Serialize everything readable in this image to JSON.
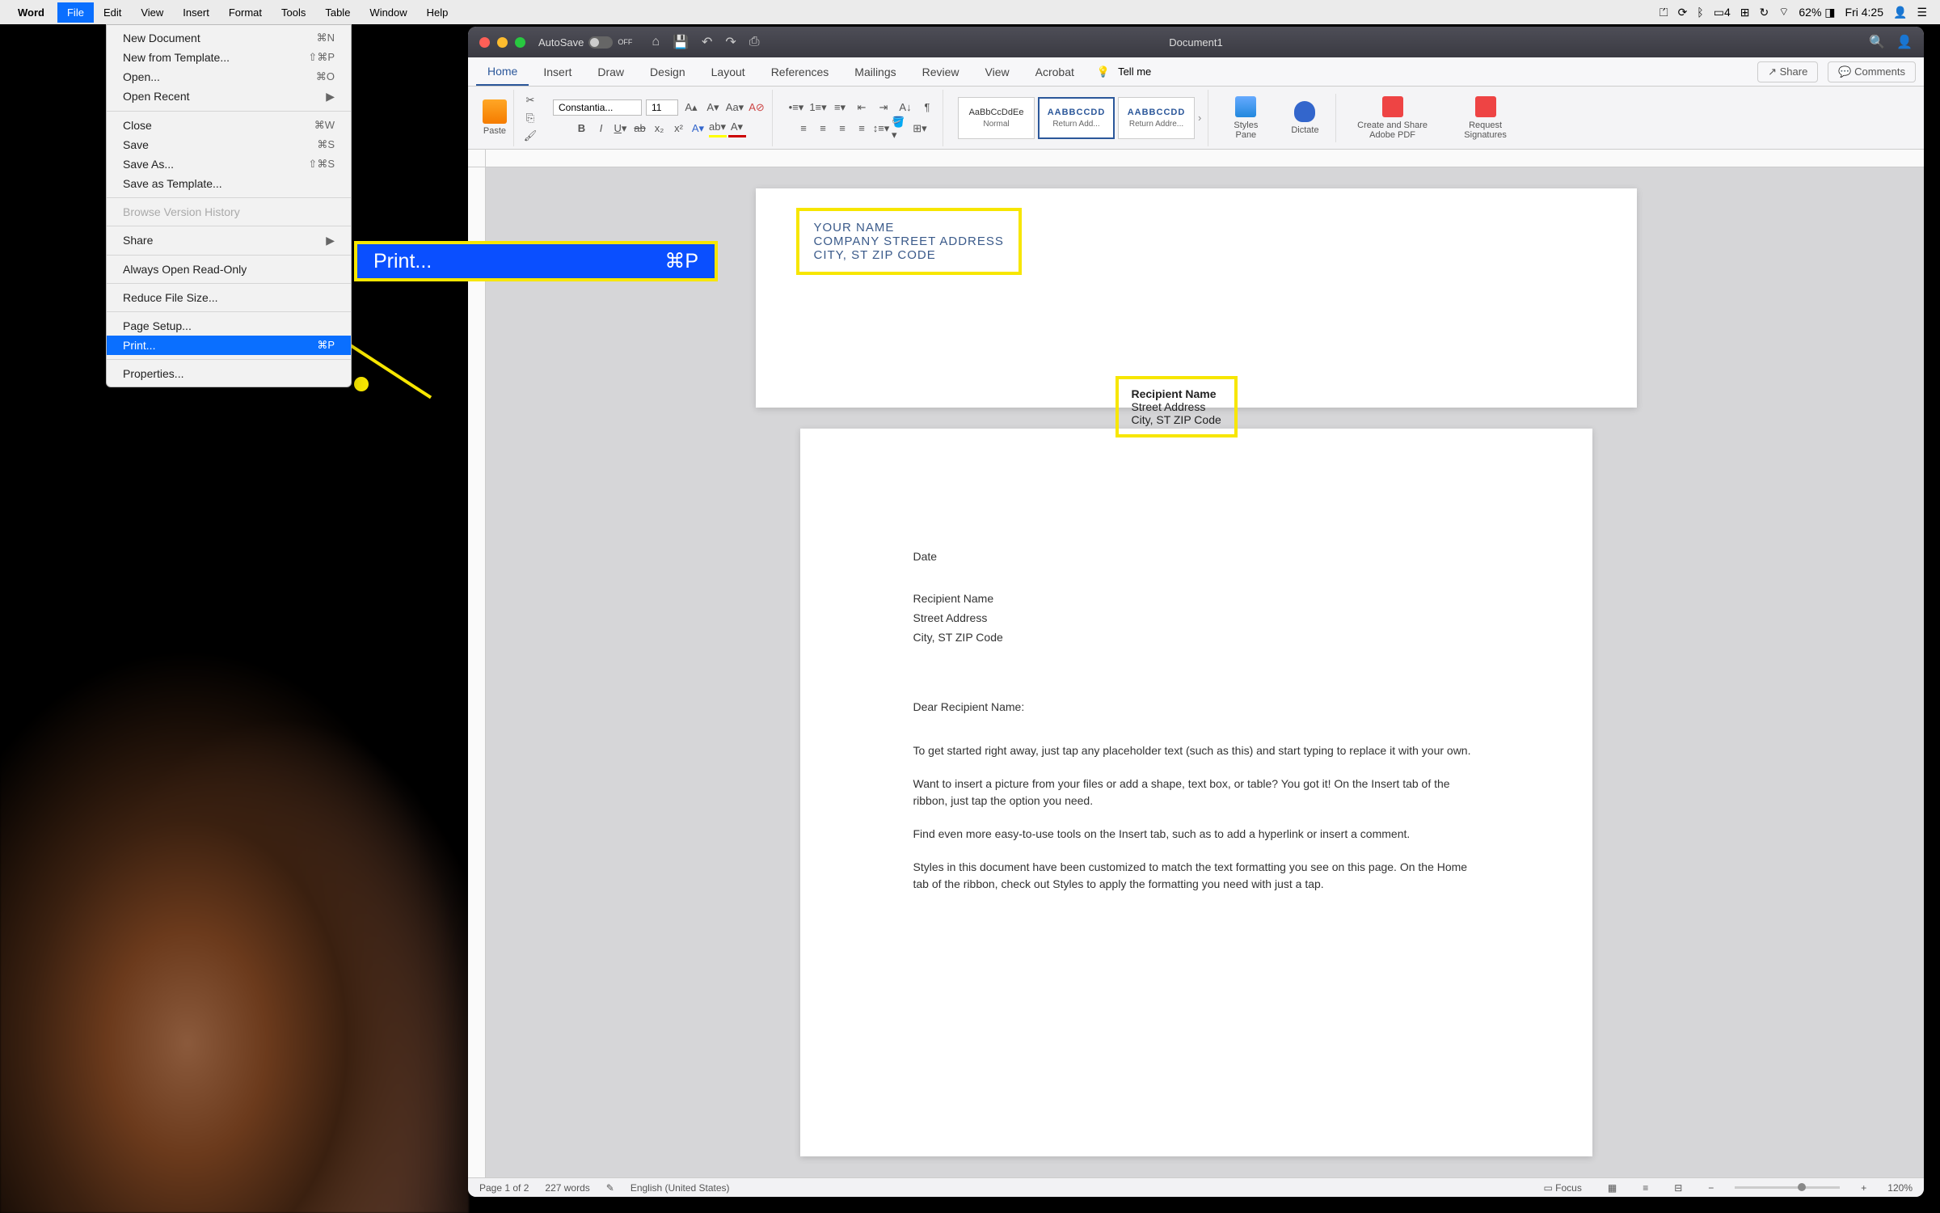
{
  "menubar": {
    "app_name": "Word",
    "items": [
      "File",
      "Edit",
      "View",
      "Insert",
      "Format",
      "Tools",
      "Table",
      "Window",
      "Help"
    ],
    "active_index": 0,
    "right": {
      "battery": "62%",
      "time": "Fri 4:25",
      "calendar_num": "4"
    }
  },
  "file_menu": {
    "items": [
      {
        "label": "New Document",
        "shortcut": "⌘N"
      },
      {
        "label": "New from Template...",
        "shortcut": "⇧⌘P"
      },
      {
        "label": "Open...",
        "shortcut": "⌘O"
      },
      {
        "label": "Open Recent",
        "arrow": true
      },
      {
        "sep": true
      },
      {
        "label": "Close",
        "shortcut": "⌘W"
      },
      {
        "label": "Save",
        "shortcut": "⌘S"
      },
      {
        "label": "Save As...",
        "shortcut": "⇧⌘S"
      },
      {
        "label": "Save as Template..."
      },
      {
        "sep": true
      },
      {
        "label": "Browse Version History",
        "disabled": true
      },
      {
        "sep": true
      },
      {
        "label": "Share",
        "arrow": true
      },
      {
        "sep": true
      },
      {
        "label": "Always Open Read-Only"
      },
      {
        "sep": true
      },
      {
        "label": "Reduce File Size..."
      },
      {
        "sep": true
      },
      {
        "label": "Page Setup..."
      },
      {
        "label": "Print...",
        "shortcut": "⌘P",
        "highlighted": true
      },
      {
        "sep": true
      },
      {
        "label": "Properties..."
      }
    ]
  },
  "callout": {
    "label": "Print...",
    "shortcut": "⌘P"
  },
  "word": {
    "title": "Document1",
    "autosave": "AutoSave",
    "autosave_state": "OFF",
    "tabs": [
      "Home",
      "Insert",
      "Draw",
      "Design",
      "Layout",
      "References",
      "Mailings",
      "Review",
      "View",
      "Acrobat"
    ],
    "active_tab": 0,
    "tellme": "Tell me",
    "share": "Share",
    "comments": "Comments",
    "ribbon": {
      "paste": "Paste",
      "font": "Constantia...",
      "size": "11",
      "styles": [
        {
          "sample": "AaBbCcDdEe",
          "name": "Normal"
        },
        {
          "sample": "AABBCCDD",
          "name": "Return Add..."
        },
        {
          "sample": "AABBCCDD",
          "name": "Return Addre..."
        }
      ],
      "big_buttons": [
        "Styles Pane",
        "Dictate",
        "Create and Share Adobe PDF",
        "Request Signatures"
      ]
    },
    "envelope": {
      "sender": {
        "name": "YOUR NAME",
        "street": "COMPANY STREET ADDRESS",
        "city": "CITY, ST ZIP CODE"
      },
      "recipient": {
        "name": "Recipient Name",
        "street": "Street Address",
        "city": "City, ST ZIP Code"
      }
    },
    "letter": {
      "date": "Date",
      "rec_name": "Recipient Name",
      "rec_street": "Street Address",
      "rec_city": "City, ST ZIP Code",
      "salutation": "Dear Recipient Name:",
      "p1": "To get started right away, just tap any placeholder text (such as this) and start typing to replace it with your own.",
      "p2": "Want to insert a picture from your files or add a shape, text box, or table? You got it! On the Insert tab of the ribbon, just tap the option you need.",
      "p3": "Find even more easy-to-use tools on the Insert tab, such as to add a hyperlink or insert a comment.",
      "p4": "Styles in this document have been customized to match the text formatting you see on this page. On the Home tab of the ribbon, check out Styles to apply the formatting you need with just a tap."
    },
    "status": {
      "page": "Page 1 of 2",
      "words": "227 words",
      "lang": "English (United States)",
      "focus": "Focus",
      "zoom": "120%"
    }
  }
}
